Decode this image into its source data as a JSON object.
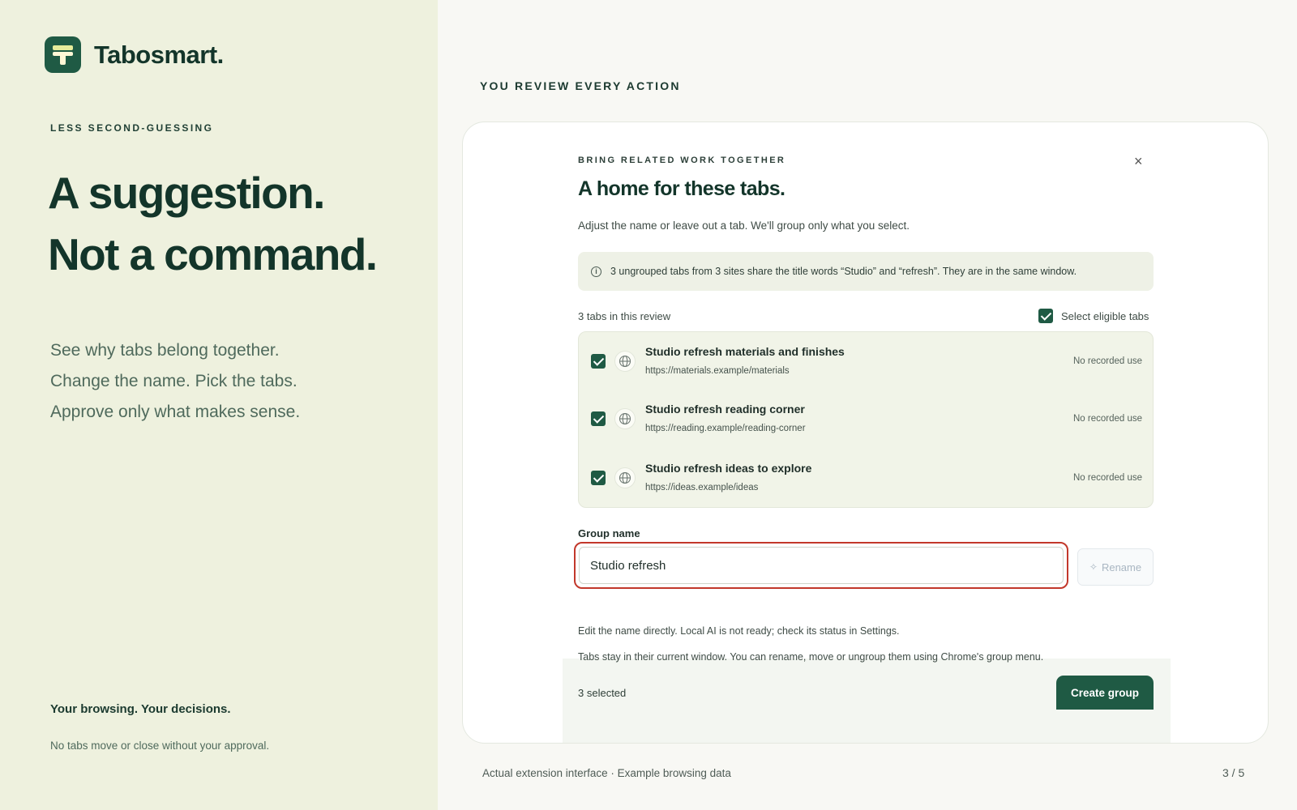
{
  "brand": {
    "name": "Tabosmart."
  },
  "left": {
    "eyebrow": "LESS SECOND-GUESSING",
    "headline_line1": "A suggestion.",
    "headline_line2": "Not a command.",
    "sub_line1": "See why tabs belong together.",
    "sub_line2": "Change the name. Pick the tabs.",
    "sub_line3": "Approve only what makes sense.",
    "footer_strong": "Your browsing. Your decisions.",
    "footer_small": "No tabs move or close without your approval."
  },
  "right": {
    "eyebrow": "YOU REVIEW EVERY ACTION",
    "caption": "Actual extension interface · Example browsing data",
    "pager": "3 / 5"
  },
  "dialog": {
    "eyebrow": "BRING RELATED WORK TOGETHER",
    "close_glyph": "×",
    "title": "A home for these tabs.",
    "description": "Adjust the name or leave out a tab. We'll group only what you select.",
    "info": "3 ungrouped tabs from 3 sites share the title words “Studio” and “refresh”. They are in the same window.",
    "count": "3 tabs in this review",
    "select_eligible": "Select eligible tabs",
    "tabs": [
      {
        "title": "Studio refresh materials and finishes",
        "url": "https://materials.example/materials",
        "usage": "No recorded use",
        "checked": true
      },
      {
        "title": "Studio refresh reading corner",
        "url": "https://reading.example/reading-corner",
        "usage": "No recorded use",
        "checked": true
      },
      {
        "title": "Studio refresh ideas to explore",
        "url": "https://ideas.example/ideas",
        "usage": "No recorded use",
        "checked": true
      }
    ],
    "group_name_label": "Group name",
    "group_name_value": "Studio refresh",
    "rename_label": "Rename",
    "note_ai": "Edit the name directly. Local AI is not ready; check its status in Settings.",
    "note_window": "Tabs stay in their current window. You can rename, move or ungroup them using Chrome's group menu.",
    "selected": "3 selected",
    "create_label": "Create group"
  },
  "colors": {
    "brand_green": "#1f5a44",
    "left_panel_bg": "#eef1de",
    "focus_ring": "#c2382b"
  }
}
